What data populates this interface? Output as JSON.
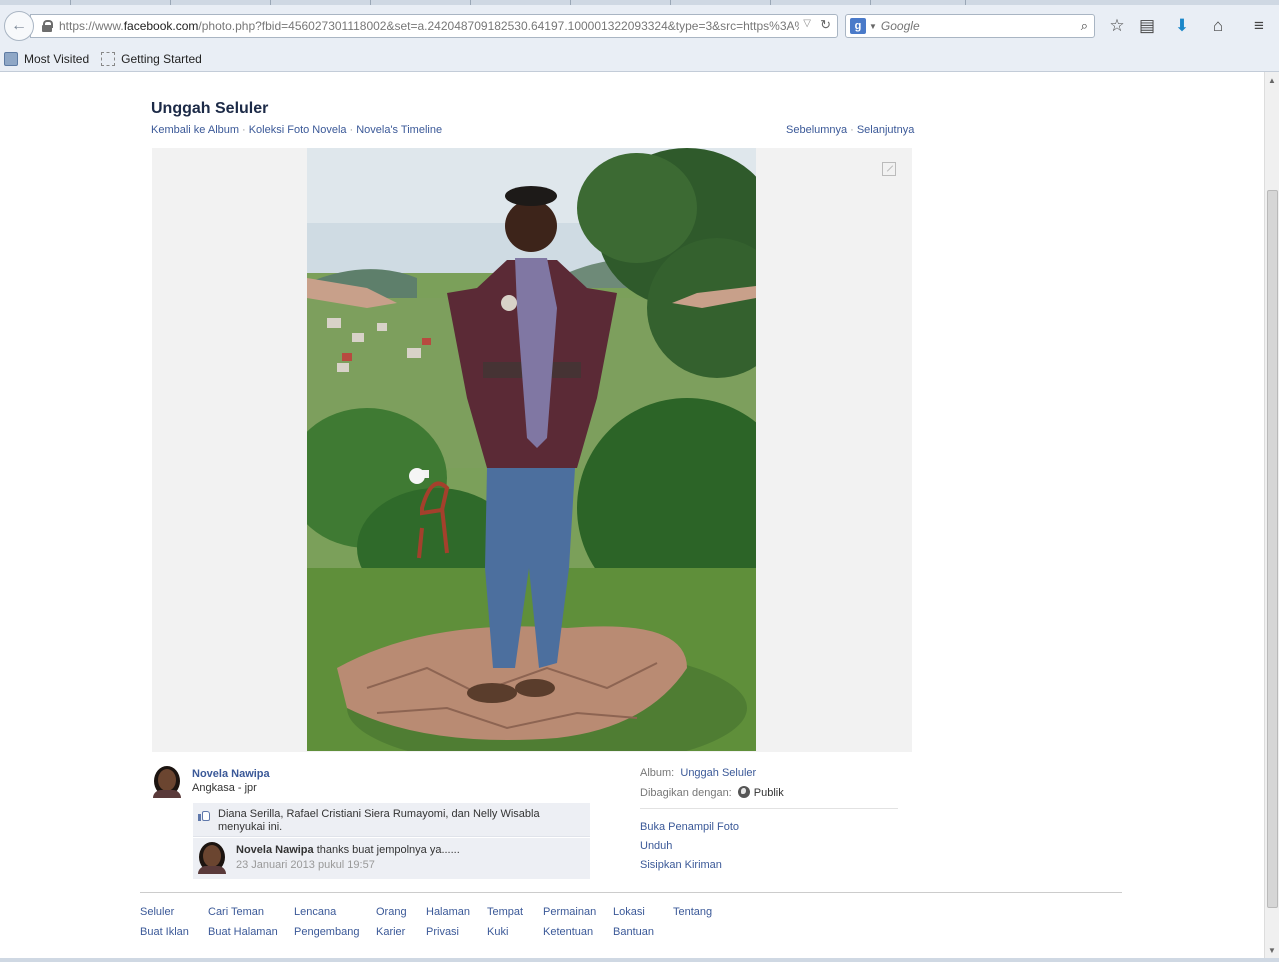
{
  "browser": {
    "url_prefix": "https://www.",
    "url_host": "facebook.com",
    "url_path": "/photo.php?fbid=456027301118002&set=a.242048709182530.64197.100001322093324&type=3&src=https%3A%2",
    "search_placeholder": "Google",
    "bookmarks": [
      "Most Visited",
      "Getting Started"
    ]
  },
  "page": {
    "title": "Unggah Seluler",
    "breadcrumbs": [
      "Kembali ke Album",
      "Koleksi Foto Novela",
      "Novela's Timeline"
    ],
    "pager": [
      "Sebelumnya",
      "Selanjutnya"
    ]
  },
  "owner": {
    "name": "Novela Nawipa",
    "location": "Angkasa - jpr"
  },
  "likes": {
    "text": "Diana Serilla, Rafael Cristiani Siera Rumayomi, dan Nelly Wisabla menyukai ini."
  },
  "comment": {
    "author": "Novela Nawipa",
    "text": "thanks buat jempolnya ya......",
    "time": "23 Januari 2013 pukul 19:57"
  },
  "meta": {
    "album_label": "Album:",
    "album_value": "Unggah Seluler",
    "shared_label": "Dibagikan dengan:",
    "shared_value": "Publik",
    "actions": [
      "Buka Penampil Foto",
      "Unduh",
      "Sisipkan Kiriman"
    ]
  },
  "footer": {
    "row1": [
      "Seluler",
      "Cari Teman",
      "Lencana",
      "Orang",
      "Halaman",
      "Tempat",
      "Permainan",
      "Lokasi",
      "Tentang"
    ],
    "row2": [
      "Buat Iklan",
      "Buat Halaman",
      "Pengembang",
      "Karier",
      "Privasi",
      "Kuki",
      "Ketentuan",
      "Bantuan"
    ]
  }
}
